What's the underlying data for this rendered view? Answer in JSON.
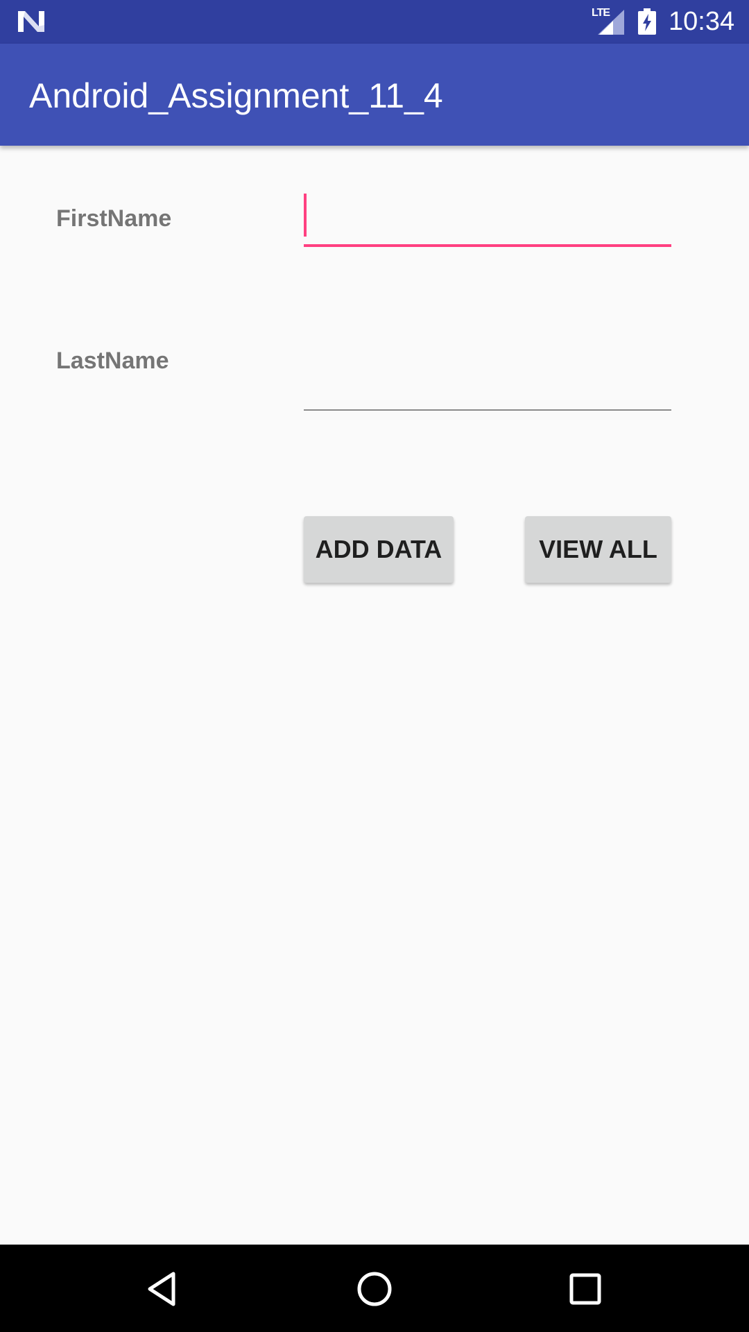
{
  "status_bar": {
    "network_label": "LTE",
    "time": "10:34",
    "icons": [
      "notification-n-icon",
      "signal-icon",
      "battery-charging-icon"
    ]
  },
  "app_bar": {
    "title": "Android_Assignment_11_4",
    "color": "#3f51b5",
    "status_color": "#303f9f"
  },
  "form": {
    "first_name": {
      "label": "FirstName",
      "value": "",
      "accent": "#ff4081"
    },
    "last_name": {
      "label": "LastName",
      "value": ""
    }
  },
  "buttons": {
    "add_data": "ADD DATA",
    "view_all": "VIEW ALL"
  },
  "nav_bar": {
    "icons": [
      "back-icon",
      "home-icon",
      "recents-icon"
    ]
  }
}
